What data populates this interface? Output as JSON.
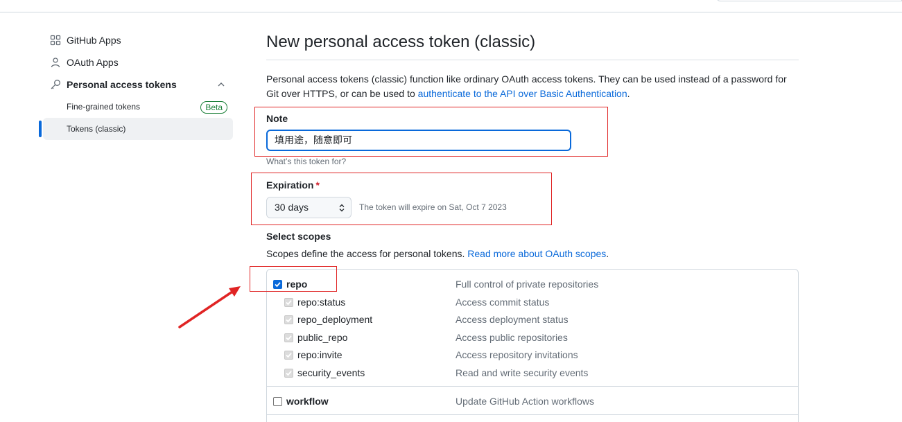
{
  "sidebar": {
    "items": [
      {
        "label": "GitHub Apps",
        "icon": "apps-grid-icon"
      },
      {
        "label": "OAuth Apps",
        "icon": "person-icon"
      },
      {
        "label": "Personal access tokens",
        "icon": "key-icon"
      }
    ],
    "sub_items": [
      {
        "label": "Fine-grained tokens",
        "badge": "Beta"
      },
      {
        "label": "Tokens (classic)"
      }
    ]
  },
  "main": {
    "title": "New personal access token (classic)",
    "intro_text": "Personal access tokens (classic) function like ordinary OAuth access tokens. They can be used instead of a password for Git over HTTPS, or can be used to ",
    "intro_link": "authenticate to the API over Basic Authentication",
    "intro_end": ".",
    "note": {
      "label": "Note",
      "value": "填用途，随意即可",
      "hint": "What’s this token for?"
    },
    "expiration": {
      "label": "Expiration",
      "required_mark": "*",
      "selected": "30 days",
      "note": "The token will expire on Sat, Oct 7 2023"
    },
    "scopes": {
      "heading": "Select scopes",
      "desc_text": "Scopes define the access for personal tokens. ",
      "desc_link": "Read more about OAuth scopes",
      "desc_end": ".",
      "rows": [
        {
          "name": "repo",
          "desc": "Full control of private repositories"
        },
        {
          "name": "repo:status",
          "desc": "Access commit status"
        },
        {
          "name": "repo_deployment",
          "desc": "Access deployment status"
        },
        {
          "name": "public_repo",
          "desc": "Access public repositories"
        },
        {
          "name": "repo:invite",
          "desc": "Access repository invitations"
        },
        {
          "name": "security_events",
          "desc": "Read and write security events"
        },
        {
          "name": "workflow",
          "desc": "Update GitHub Action workflows"
        }
      ]
    }
  },
  "colors": {
    "accent": "#0969da",
    "annotation": "#e02424",
    "success": "#1a7f37"
  }
}
